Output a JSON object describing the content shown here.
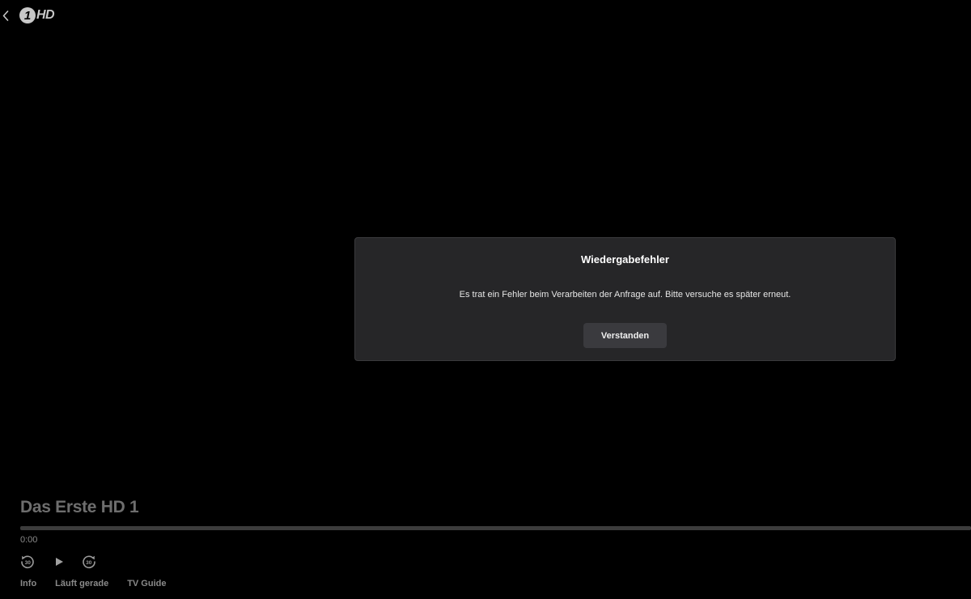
{
  "header": {
    "back_icon": "chevron-left-icon",
    "logo": {
      "digit": "1",
      "text": "HD"
    }
  },
  "dialog": {
    "title": "Wiedergabefehler",
    "message": "Es trat ein Fehler beim Verarbeiten der Anfrage auf. Bitte versuche es später erneut.",
    "button_label": "Verstanden"
  },
  "player": {
    "program_title": "Das Erste HD 1",
    "current_time": "0:00",
    "progress_fraction": 0,
    "rewind_label": "30",
    "forward_label": "30",
    "controls": {
      "rewind_icon": "rewind-30-icon",
      "play_icon": "play-icon",
      "forward_icon": "forward-30-icon"
    }
  },
  "tabs": [
    {
      "label": "Info"
    },
    {
      "label": "Läuft gerade"
    },
    {
      "label": "TV Guide"
    }
  ],
  "colors": {
    "background": "#000000",
    "dialog_bg": "#262628",
    "button_bg": "#3a3a3e",
    "muted_text": "#8a8a8a"
  }
}
